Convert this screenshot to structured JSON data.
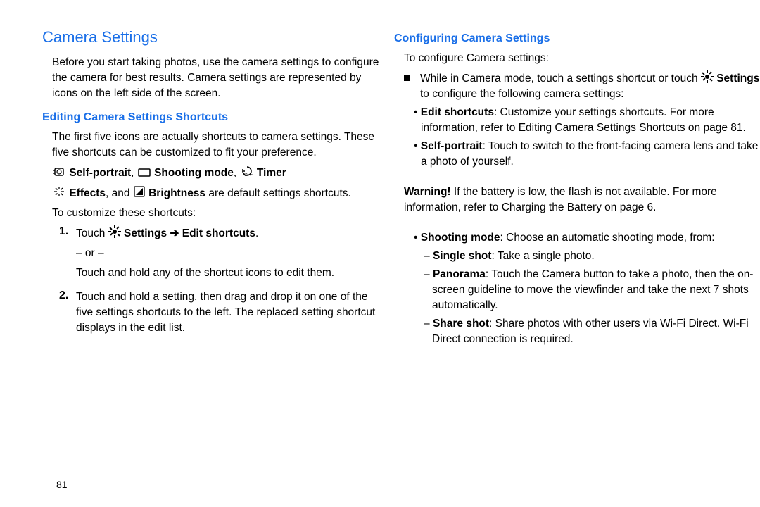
{
  "page_number": "81",
  "left": {
    "h1": "Camera Settings",
    "intro": "Before you start taking photos, use the camera settings to configure the camera for best results. Camera settings are represented by icons on the left side of the screen.",
    "h2": "Editing Camera Settings Shortcuts",
    "p1": "The first five icons are actually shortcuts to camera settings. These five shortcuts can be customized to fit your preference.",
    "defaults_self_portrait": "Self-portrait",
    "defaults_shooting_mode": "Shooting mode",
    "defaults_timer": "Timer",
    "defaults_effects": "Effects",
    "defaults_brightness": "Brightness",
    "defaults_tail": " are default settings shortcuts.",
    "customize_intro": "To customize these shortcuts:",
    "step1_pre": "Touch ",
    "step1_settings": "Settings",
    "step1_arrow": " ➔ ",
    "step1_edit": "Edit shortcuts",
    "step1_period": ".",
    "step1_or": "– or –",
    "step1_alt": "Touch and hold any of the shortcut icons to edit them.",
    "step2": "Touch and hold a setting, then drag and drop it on one of the five settings shortcuts to the left. The replaced setting shortcut displays in the edit list."
  },
  "right": {
    "h2": "Configuring Camera Settings",
    "intro": "To configure Camera settings:",
    "bullet1_a": "While in Camera mode, touch a settings shortcut or touch ",
    "bullet1_settings": "Settings",
    "bullet1_b": " to configure the following camera settings:",
    "edit_shortcuts_label": "Edit shortcuts",
    "edit_shortcuts_text": ": Customize your settings shortcuts. For more information, refer to ",
    "edit_shortcuts_ref": "Editing Camera Settings Shortcuts",
    "edit_shortcuts_tail": " on page 81.",
    "self_portrait_label": "Self-portrait",
    "self_portrait_text": ": Touch to switch to the front-facing camera lens and take a photo of yourself.",
    "warning_label": "Warning!",
    "warning_text_a": " If the battery is low, the flash is not available. For more information, refer to ",
    "warning_ref": "Charging the Battery",
    "warning_tail": " on page 6.",
    "shooting_mode_label": "Shooting mode",
    "shooting_mode_text": ": Choose an automatic shooting mode, from:",
    "single_shot_label": "Single shot",
    "single_shot_text": ": Take a single photo.",
    "panorama_label": "Panorama",
    "panorama_text": ": Touch the Camera button to take a photo, then the on-screen guideline to move the viewfinder and take the next 7 shots automatically.",
    "share_shot_label": "Share shot",
    "share_shot_text": ": Share photos with other users via Wi-Fi Direct. Wi-Fi Direct connection is required."
  }
}
